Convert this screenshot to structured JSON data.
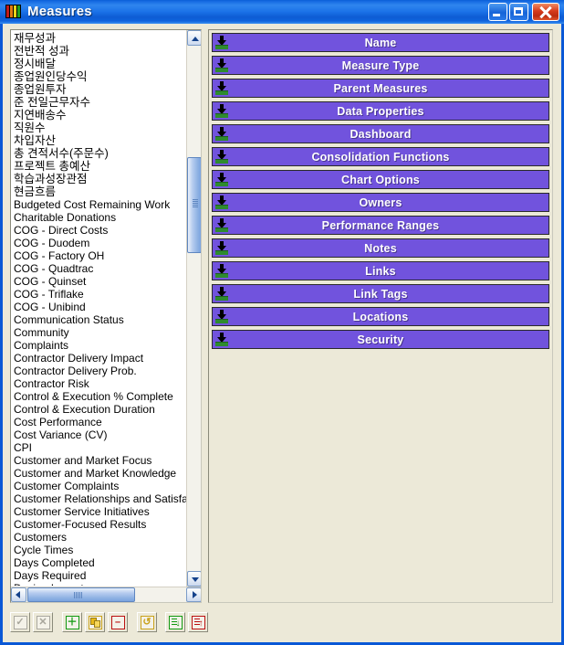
{
  "window": {
    "title": "Measures",
    "icon": "bar-chart-icon",
    "icon_bar_colors": [
      "#c01a1a",
      "#e07a12",
      "#e8d21a",
      "#1f9e1f"
    ],
    "controls": {
      "minimize": "Minimize",
      "maximize": "Maximize",
      "close": "Close"
    }
  },
  "colors": {
    "titlebar_blue": "#0b5fd8",
    "button_purple": "#7153dd",
    "panel_beige": "#ece9d8",
    "close_red": "#d63a1b",
    "scroll_blue": "#8fb2e3"
  },
  "measure_list": {
    "items": [
      "재무성과",
      "전반적 성과",
      "정시배달",
      "종업원인당수익",
      "종업원투자",
      "준 전일근무자수",
      "지연배송수",
      "직원수",
      "차입자산",
      "총 견적서수(주문수)",
      "프로젝트 총예산",
      "학습과성장관점",
      "현금흐름",
      "Budgeted Cost Remaining Work",
      "Charitable Donations",
      "COG - Direct Costs",
      "COG - Duodem",
      "COG - Factory OH",
      "COG - Quadtrac",
      "COG - Quinset",
      "COG - Triflake",
      "COG - Unibind",
      "Communication Status",
      "Community",
      "Complaints",
      "Contractor Delivery Impact",
      "Contractor Delivery Prob.",
      "Contractor Risk",
      "Control & Execution % Complete",
      "Control & Execution Duration",
      "Cost Performance",
      "Cost Variance (CV)",
      "CPI",
      "Customer and Market Focus",
      "Customer and Market Knowledge",
      "Customer Complaints",
      "Customer Relationships and Satisfactio",
      "Customer Service Initiatives",
      "Customer-Focused Results",
      "Customers",
      "Cycle Times",
      "Days Completed",
      "Days Required",
      "Design Impact"
    ],
    "korean_count": 13,
    "scrollbar": {
      "vertical_up": "scroll-up",
      "vertical_down": "scroll-down",
      "horizontal_left": "scroll-left",
      "horizontal_right": "scroll-right"
    }
  },
  "property_buttons": [
    {
      "label": "Name",
      "icon": "download-arrow-icon"
    },
    {
      "label": "Measure Type",
      "icon": "download-arrow-icon"
    },
    {
      "label": "Parent Measures",
      "icon": "download-arrow-icon"
    },
    {
      "label": "Data Properties",
      "icon": "download-arrow-icon"
    },
    {
      "label": "Dashboard",
      "icon": "download-arrow-icon"
    },
    {
      "label": "Consolidation Functions",
      "icon": "download-arrow-icon"
    },
    {
      "label": "Chart Options",
      "icon": "download-arrow-icon"
    },
    {
      "label": "Owners",
      "icon": "download-arrow-icon"
    },
    {
      "label": "Performance Ranges",
      "icon": "download-arrow-icon"
    },
    {
      "label": "Notes",
      "icon": "download-arrow-icon"
    },
    {
      "label": "Links",
      "icon": "download-arrow-icon"
    },
    {
      "label": "Link Tags",
      "icon": "download-arrow-icon"
    },
    {
      "label": "Locations",
      "icon": "download-arrow-icon"
    },
    {
      "label": "Security",
      "icon": "download-arrow-icon"
    }
  ],
  "toolbar": [
    {
      "name": "confirm-button",
      "icon": "checkmark-icon",
      "glyph": "✓",
      "color": "#a8a69c",
      "enabled": false,
      "style": "dis"
    },
    {
      "name": "cancel-button",
      "icon": "cross-icon",
      "glyph": "✕",
      "color": "#a8a69c",
      "enabled": false,
      "style": "dis"
    },
    {
      "name": "add-button",
      "icon": "plus-icon",
      "glyph": "＋",
      "color": "#119a11",
      "enabled": true,
      "style": "g"
    },
    {
      "name": "copy-button",
      "icon": "copy-icon",
      "glyph": "",
      "color": "#e8b81a",
      "enabled": true,
      "style": "y"
    },
    {
      "name": "delete-button",
      "icon": "minus-icon",
      "glyph": "–",
      "color": "#bb1111",
      "enabled": true,
      "style": "r"
    },
    {
      "name": "refresh-button",
      "icon": "refresh-icon",
      "glyph": "↺",
      "color": "#c9a21a",
      "enabled": true,
      "style": "y"
    },
    {
      "name": "import-button",
      "icon": "import-list-icon",
      "glyph": "↓",
      "color": "#119a11",
      "enabled": true,
      "style": "g"
    },
    {
      "name": "export-button",
      "icon": "export-list-icon",
      "glyph": "↑",
      "color": "#bb1111",
      "enabled": true,
      "style": "r"
    }
  ]
}
